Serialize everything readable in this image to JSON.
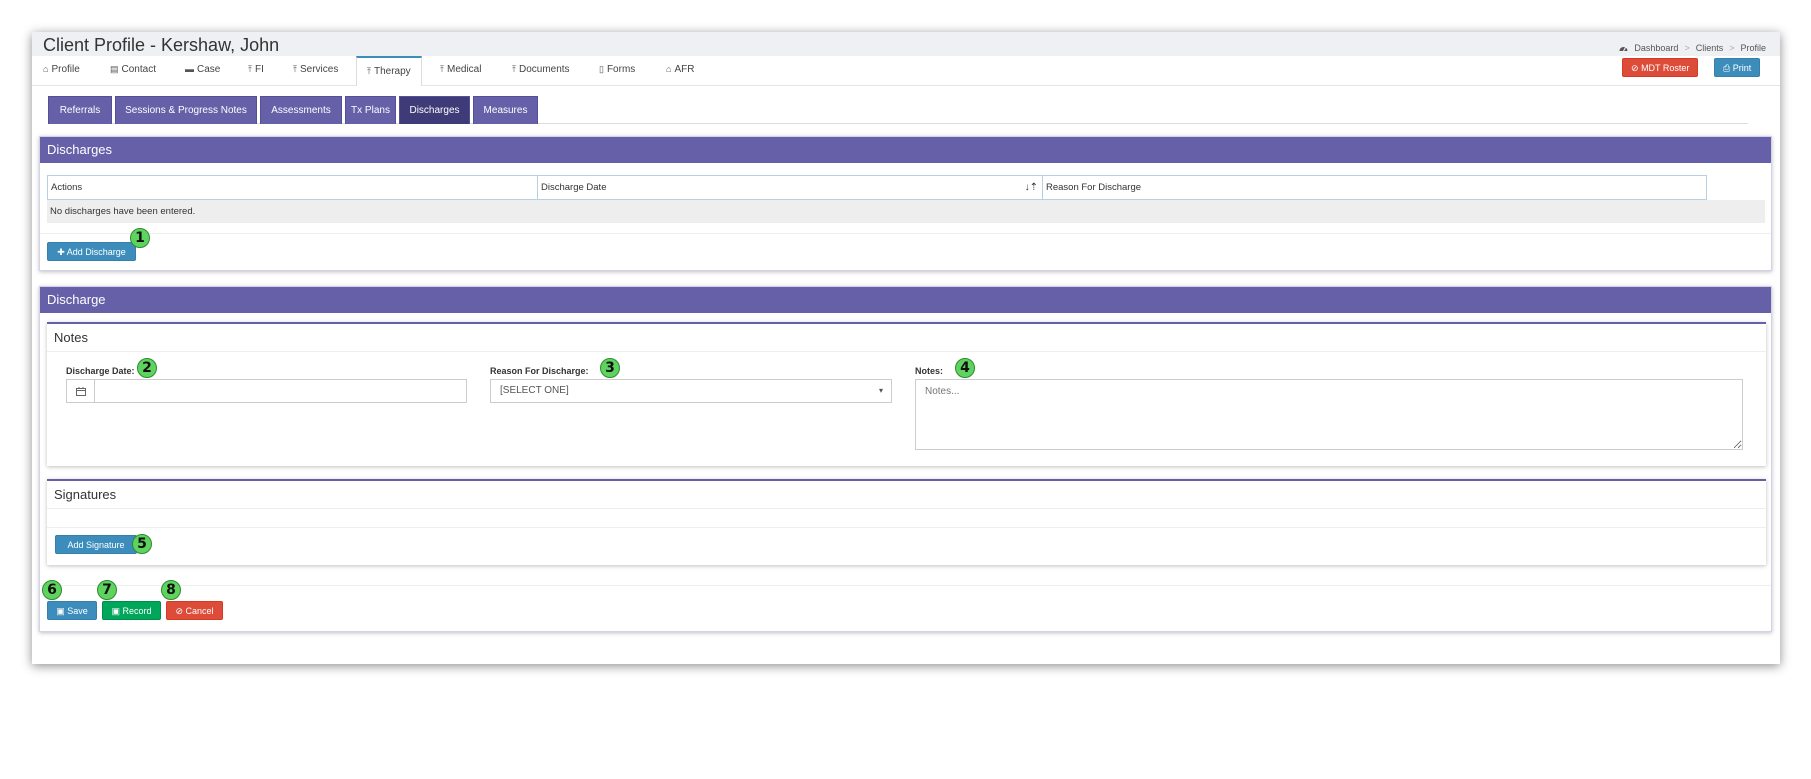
{
  "header": {
    "title": "Client Profile - Kershaw, John",
    "breadcrumb": [
      "Dashboard",
      "Clients",
      "Profile"
    ],
    "breadcrumb_sep": ">"
  },
  "top_tabs": [
    {
      "label": "Profile",
      "icon": "home-icon",
      "glyph": "⌂"
    },
    {
      "label": "Contact",
      "icon": "contact-card-icon",
      "glyph": "▤"
    },
    {
      "label": "Case",
      "icon": "briefcase-icon",
      "glyph": "▬"
    },
    {
      "label": "FI",
      "icon": "pin-icon",
      "glyph": "⤒"
    },
    {
      "label": "Services",
      "icon": "pin-icon",
      "glyph": "⤒"
    },
    {
      "label": "Therapy",
      "icon": "pin-icon",
      "glyph": "⤒"
    },
    {
      "label": "Medical",
      "icon": "pin-icon",
      "glyph": "⤒"
    },
    {
      "label": "Documents",
      "icon": "pin-icon",
      "glyph": "⤒"
    },
    {
      "label": "Forms",
      "icon": "file-icon",
      "glyph": "▯"
    },
    {
      "label": "AFR",
      "icon": "home-icon",
      "glyph": "⌂"
    }
  ],
  "top_buttons": {
    "mdt_roster": "MDT Roster",
    "print": "Print"
  },
  "sub_tabs": [
    "Referrals",
    "Sessions & Progress Notes",
    "Assessments",
    "Tx Plans",
    "Discharges",
    "Measures"
  ],
  "discharges_panel": {
    "title": "Discharges",
    "columns": [
      "Actions",
      "Discharge Date",
      "Reason For Discharge"
    ],
    "empty_text": "No discharges have been entered.",
    "add_button": "Add Discharge"
  },
  "discharge_panel": {
    "title": "Discharge",
    "notes_card": {
      "title": "Notes",
      "discharge_date_label": "Discharge Date:",
      "discharge_date_value": "",
      "reason_label": "Reason For Discharge:",
      "reason_value": "[SELECT ONE]",
      "notes_label": "Notes:",
      "notes_placeholder": "Notes..."
    },
    "signatures_card": {
      "title": "Signatures",
      "add_signature": "Add Signature"
    },
    "actions": {
      "save": "Save",
      "record": "Record",
      "cancel": "Cancel"
    }
  },
  "markers": [
    "1",
    "2",
    "3",
    "4",
    "5",
    "6",
    "7",
    "8"
  ],
  "colors": {
    "purple": "#6560a8",
    "purple_active": "#3f3b78",
    "blue": "#3c8dbc",
    "green": "#00a65a",
    "red": "#dd4b39",
    "marker": "#5fd35f"
  }
}
